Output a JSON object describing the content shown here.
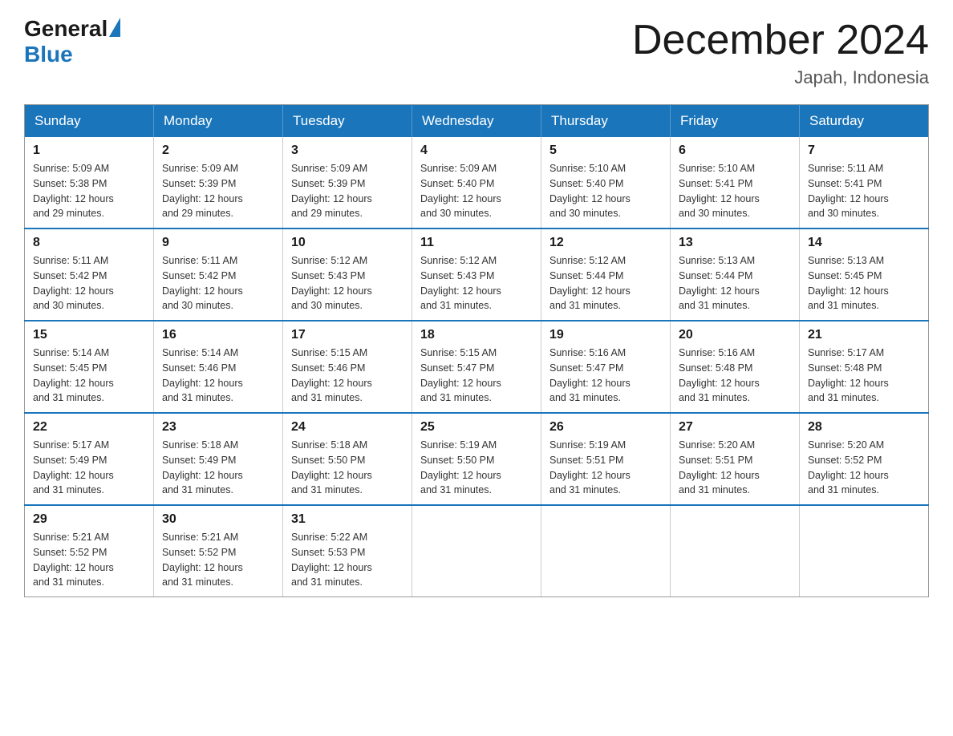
{
  "header": {
    "logo": {
      "general_text": "General",
      "blue_text": "Blue"
    },
    "title": "December 2024",
    "location": "Japah, Indonesia"
  },
  "calendar": {
    "days_of_week": [
      "Sunday",
      "Monday",
      "Tuesday",
      "Wednesday",
      "Thursday",
      "Friday",
      "Saturday"
    ],
    "weeks": [
      [
        {
          "day": "1",
          "sunrise": "5:09 AM",
          "sunset": "5:38 PM",
          "daylight": "12 hours and 29 minutes."
        },
        {
          "day": "2",
          "sunrise": "5:09 AM",
          "sunset": "5:39 PM",
          "daylight": "12 hours and 29 minutes."
        },
        {
          "day": "3",
          "sunrise": "5:09 AM",
          "sunset": "5:39 PM",
          "daylight": "12 hours and 29 minutes."
        },
        {
          "day": "4",
          "sunrise": "5:09 AM",
          "sunset": "5:40 PM",
          "daylight": "12 hours and 30 minutes."
        },
        {
          "day": "5",
          "sunrise": "5:10 AM",
          "sunset": "5:40 PM",
          "daylight": "12 hours and 30 minutes."
        },
        {
          "day": "6",
          "sunrise": "5:10 AM",
          "sunset": "5:41 PM",
          "daylight": "12 hours and 30 minutes."
        },
        {
          "day": "7",
          "sunrise": "5:11 AM",
          "sunset": "5:41 PM",
          "daylight": "12 hours and 30 minutes."
        }
      ],
      [
        {
          "day": "8",
          "sunrise": "5:11 AM",
          "sunset": "5:42 PM",
          "daylight": "12 hours and 30 minutes."
        },
        {
          "day": "9",
          "sunrise": "5:11 AM",
          "sunset": "5:42 PM",
          "daylight": "12 hours and 30 minutes."
        },
        {
          "day": "10",
          "sunrise": "5:12 AM",
          "sunset": "5:43 PM",
          "daylight": "12 hours and 30 minutes."
        },
        {
          "day": "11",
          "sunrise": "5:12 AM",
          "sunset": "5:43 PM",
          "daylight": "12 hours and 31 minutes."
        },
        {
          "day": "12",
          "sunrise": "5:12 AM",
          "sunset": "5:44 PM",
          "daylight": "12 hours and 31 minutes."
        },
        {
          "day": "13",
          "sunrise": "5:13 AM",
          "sunset": "5:44 PM",
          "daylight": "12 hours and 31 minutes."
        },
        {
          "day": "14",
          "sunrise": "5:13 AM",
          "sunset": "5:45 PM",
          "daylight": "12 hours and 31 minutes."
        }
      ],
      [
        {
          "day": "15",
          "sunrise": "5:14 AM",
          "sunset": "5:45 PM",
          "daylight": "12 hours and 31 minutes."
        },
        {
          "day": "16",
          "sunrise": "5:14 AM",
          "sunset": "5:46 PM",
          "daylight": "12 hours and 31 minutes."
        },
        {
          "day": "17",
          "sunrise": "5:15 AM",
          "sunset": "5:46 PM",
          "daylight": "12 hours and 31 minutes."
        },
        {
          "day": "18",
          "sunrise": "5:15 AM",
          "sunset": "5:47 PM",
          "daylight": "12 hours and 31 minutes."
        },
        {
          "day": "19",
          "sunrise": "5:16 AM",
          "sunset": "5:47 PM",
          "daylight": "12 hours and 31 minutes."
        },
        {
          "day": "20",
          "sunrise": "5:16 AM",
          "sunset": "5:48 PM",
          "daylight": "12 hours and 31 minutes."
        },
        {
          "day": "21",
          "sunrise": "5:17 AM",
          "sunset": "5:48 PM",
          "daylight": "12 hours and 31 minutes."
        }
      ],
      [
        {
          "day": "22",
          "sunrise": "5:17 AM",
          "sunset": "5:49 PM",
          "daylight": "12 hours and 31 minutes."
        },
        {
          "day": "23",
          "sunrise": "5:18 AM",
          "sunset": "5:49 PM",
          "daylight": "12 hours and 31 minutes."
        },
        {
          "day": "24",
          "sunrise": "5:18 AM",
          "sunset": "5:50 PM",
          "daylight": "12 hours and 31 minutes."
        },
        {
          "day": "25",
          "sunrise": "5:19 AM",
          "sunset": "5:50 PM",
          "daylight": "12 hours and 31 minutes."
        },
        {
          "day": "26",
          "sunrise": "5:19 AM",
          "sunset": "5:51 PM",
          "daylight": "12 hours and 31 minutes."
        },
        {
          "day": "27",
          "sunrise": "5:20 AM",
          "sunset": "5:51 PM",
          "daylight": "12 hours and 31 minutes."
        },
        {
          "day": "28",
          "sunrise": "5:20 AM",
          "sunset": "5:52 PM",
          "daylight": "12 hours and 31 minutes."
        }
      ],
      [
        {
          "day": "29",
          "sunrise": "5:21 AM",
          "sunset": "5:52 PM",
          "daylight": "12 hours and 31 minutes."
        },
        {
          "day": "30",
          "sunrise": "5:21 AM",
          "sunset": "5:52 PM",
          "daylight": "12 hours and 31 minutes."
        },
        {
          "day": "31",
          "sunrise": "5:22 AM",
          "sunset": "5:53 PM",
          "daylight": "12 hours and 31 minutes."
        },
        null,
        null,
        null,
        null
      ]
    ],
    "labels": {
      "sunrise_prefix": "Sunrise: ",
      "sunset_prefix": "Sunset: ",
      "daylight_prefix": "Daylight: "
    }
  }
}
